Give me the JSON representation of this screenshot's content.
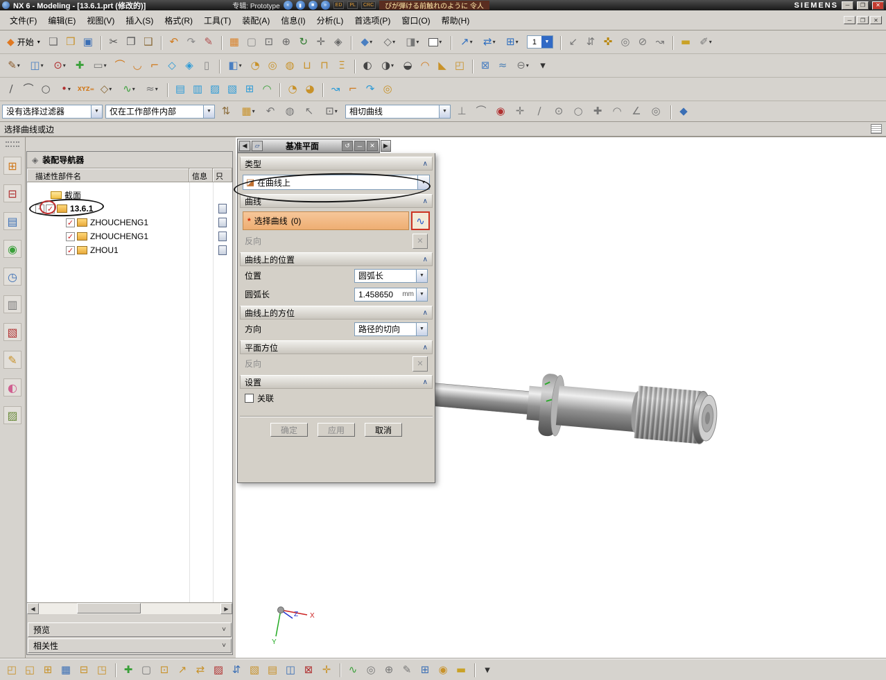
{
  "titlebar": {
    "title": "NX 6 - Modeling - [13.6.1.prt (修改的)]",
    "task_label": "专辑: Prototype",
    "media": [
      {
        "n": "recorder-prev-button",
        "g": "«"
      },
      {
        "n": "recorder-pause-button",
        "g": "▮"
      },
      {
        "n": "recorder-stop-button",
        "g": "■"
      },
      {
        "n": "recorder-next-button",
        "g": "»"
      }
    ],
    "rec_badges": [
      "ED",
      "PL",
      "CRC"
    ],
    "marquee": "ぴが弾ける前触れのように 令人",
    "brand": "SIEMENS"
  },
  "menubar": {
    "items": [
      "文件(F)",
      "编辑(E)",
      "视图(V)",
      "插入(S)",
      "格式(R)",
      "工具(T)",
      "装配(A)",
      "信息(I)",
      "分析(L)",
      "首选项(P)",
      "窗口(O)",
      "帮助(H)"
    ]
  },
  "toolbars": {
    "start_label": "开始",
    "start_icon": "◆",
    "layer_value": "1",
    "row1a": [
      {
        "n": "new-file-icon",
        "g": "❏",
        "c": "#6a6a6a"
      },
      {
        "n": "open-file-icon",
        "g": "❒",
        "c": "#c8922a"
      },
      {
        "n": "save-icon",
        "g": "▣",
        "c": "#3b6fb5"
      },
      {
        "n": "cut-icon",
        "g": "✂",
        "c": "#555555",
        "sep": true
      },
      {
        "n": "copy-icon",
        "g": "❐",
        "c": "#555555"
      },
      {
        "n": "paste-icon",
        "g": "❑",
        "c": "#8a6b3a"
      },
      {
        "n": "undo-icon",
        "g": "↶",
        "c": "#d07a1e",
        "sep": true
      },
      {
        "n": "redo-icon",
        "g": "↷",
        "c": "#8a8a8a"
      },
      {
        "n": "command-finder-icon",
        "g": "✎",
        "c": "#b05050"
      },
      {
        "n": "window-fit-icon",
        "g": "▦",
        "c": "#d9822a",
        "sep": true
      },
      {
        "n": "display-box-icon",
        "g": "▢",
        "c": "#8a8a8a"
      },
      {
        "n": "zoom-window-icon",
        "g": "⊡",
        "c": "#666666"
      },
      {
        "n": "zoom-in-icon",
        "g": "⊕",
        "c": "#666666"
      },
      {
        "n": "rotate-view-icon",
        "g": "↻",
        "c": "#2d7a2d"
      },
      {
        "n": "pan-view-icon",
        "g": "✛",
        "c": "#666666"
      },
      {
        "n": "perspective-icon",
        "g": "◈",
        "c": "#666666"
      },
      {
        "n": "shaded-display-icon",
        "g": "◆",
        "c": "#4a7fc1",
        "d": true,
        "sep": true
      },
      {
        "n": "wireframe-display-icon",
        "g": "◇",
        "c": "#666666",
        "d": true
      },
      {
        "n": "render-style-icon",
        "g": "◨",
        "c": "#777777",
        "d": true
      },
      {
        "n": "background-swatch-icon",
        "g": "",
        "c": "#ffffff",
        "cls": "swatch",
        "d": true
      },
      {
        "n": "move-object-icon",
        "g": "↗",
        "c": "#2f6fbf",
        "d": true,
        "sep": true
      },
      {
        "n": "copy-object-icon",
        "g": "⇄",
        "c": "#2f6fbf",
        "d": true
      },
      {
        "n": "pattern-object-icon",
        "g": "⊞",
        "c": "#2f6fbf",
        "d": true
      }
    ],
    "row1b": [
      {
        "n": "snap-handles-icon",
        "g": "↙",
        "c": "#777777",
        "sep": true
      },
      {
        "n": "snap-align-icon",
        "g": "⇵",
        "c": "#777777"
      },
      {
        "n": "selection-flower-icon",
        "g": "✜",
        "c": "#b8860b"
      },
      {
        "n": "target-point-icon",
        "g": "◎",
        "c": "#777777"
      },
      {
        "n": "no-selection-icon",
        "g": "⊘",
        "c": "#777777"
      },
      {
        "n": "quick-pick-icon",
        "g": "↝",
        "c": "#777777"
      },
      {
        "n": "measure-ruler-icon",
        "g": "▬",
        "c": "#c9a227",
        "sep": true
      },
      {
        "n": "annotation-pencil-icon",
        "g": "✐",
        "c": "#777777",
        "d": true
      }
    ],
    "row2": [
      {
        "n": "sketch-icon",
        "g": "✎",
        "c": "#8a5a2a",
        "d": true
      },
      {
        "n": "datum-plane-icon",
        "g": "◫",
        "c": "#4a7fc1",
        "d": true
      },
      {
        "n": "point-icon",
        "g": "⊙",
        "c": "#b03030",
        "d": true
      },
      {
        "n": "plus-icon",
        "g": "✚",
        "c": "#3aa03a"
      },
      {
        "n": "rect-icon",
        "g": "▭",
        "c": "#777777",
        "d": true
      },
      {
        "n": "arc-icon",
        "g": "⌒",
        "c": "#d07a1e"
      },
      {
        "n": "fillet-icon",
        "g": "◡",
        "c": "#d07a1e"
      },
      {
        "n": "profile-icon",
        "g": "⌐",
        "c": "#d07a1e"
      },
      {
        "n": "studio-surface-icon",
        "g": "◇",
        "c": "#2e9bd6"
      },
      {
        "n": "face-icon",
        "g": "◈",
        "c": "#2e9bd6"
      },
      {
        "n": "sheet-icon",
        "g": "▯",
        "c": "#888888"
      },
      {
        "n": "extrude-icon",
        "g": "◧",
        "c": "#4a7fc1",
        "d": true,
        "sep": true
      },
      {
        "n": "revolve-icon",
        "g": "◔",
        "c": "#c8922a"
      },
      {
        "n": "hole-icon",
        "g": "◎",
        "c": "#c8922a"
      },
      {
        "n": "boss-icon",
        "g": "◍",
        "c": "#c8922a"
      },
      {
        "n": "pocket-icon",
        "g": "⊔",
        "c": "#c8922a"
      },
      {
        "n": "pad-icon",
        "g": "⊓",
        "c": "#c8922a"
      },
      {
        "n": "emboss-icon",
        "g": "Ξ",
        "c": "#c8922a"
      },
      {
        "n": "unite-icon",
        "g": "◐",
        "c": "#444444",
        "sep": true
      },
      {
        "n": "subtract-icon",
        "g": "◑",
        "c": "#444444",
        "d": true
      },
      {
        "n": "intersect-icon",
        "g": "◒",
        "c": "#444444"
      },
      {
        "n": "edge-blend-icon",
        "g": "◠",
        "c": "#d07a1e"
      },
      {
        "n": "chamfer-icon",
        "g": "◣",
        "c": "#c8922a"
      },
      {
        "n": "shell-icon",
        "g": "◰",
        "c": "#c8922a"
      },
      {
        "n": "trim-body-icon",
        "g": "⊠",
        "c": "#4a7fc1",
        "sep": true
      },
      {
        "n": "sew-icon",
        "g": "≈",
        "c": "#4a7fb5"
      },
      {
        "n": "offset-icon",
        "g": "⊖",
        "c": "#777777",
        "d": true
      },
      {
        "n": "more-features-icon",
        "g": "▾",
        "c": "#333333"
      }
    ],
    "row3": [
      {
        "n": "line-icon",
        "g": "∕",
        "c": "#555555"
      },
      {
        "n": "arc-curve-icon",
        "g": "⌒",
        "c": "#555555"
      },
      {
        "n": "circle-icon",
        "g": "○",
        "c": "#555555"
      },
      {
        "n": "point-curve-icon",
        "g": "•",
        "c": "#b03030",
        "d": true
      },
      {
        "n": "xyz-icon",
        "g": "XYZ=",
        "c": "#d07a1e",
        "cls": "txtg"
      },
      {
        "n": "polygon-icon",
        "g": "◇",
        "c": "#8a6b3a",
        "d": true
      },
      {
        "n": "spline-icon",
        "g": "∿",
        "c": "#3aa03a",
        "d": true
      },
      {
        "n": "offset-curve-icon",
        "g": "≈",
        "c": "#777777",
        "d": true
      },
      {
        "n": "ruled-icon",
        "g": "▤",
        "c": "#2e9bd6",
        "sep": true
      },
      {
        "n": "through-curves-icon",
        "g": "▥",
        "c": "#2e9bd6"
      },
      {
        "n": "swept-icon",
        "g": "▨",
        "c": "#2e9bd6"
      },
      {
        "n": "n-sided-icon",
        "g": "▧",
        "c": "#2e9bd6"
      },
      {
        "n": "curve-mesh-icon",
        "g": "⊞",
        "c": "#2e9bd6"
      },
      {
        "n": "studio-spline-icon",
        "g": "◠",
        "c": "#3aa03a"
      },
      {
        "n": "extension-icon",
        "g": "◔",
        "c": "#c8922a",
        "sep": true
      },
      {
        "n": "law-extension-icon",
        "g": "◕",
        "c": "#c8922a"
      },
      {
        "n": "bridge-icon",
        "g": "↝",
        "c": "#2e9bd6",
        "sep": true
      },
      {
        "n": "corner-icon",
        "g": "⌐",
        "c": "#d07a1e"
      },
      {
        "n": "sweep-icon",
        "g": "↷",
        "c": "#2e9bd6"
      },
      {
        "n": "tube-icon",
        "g": "◎",
        "c": "#c8922a"
      }
    ]
  },
  "selection_bar": {
    "filter_value": "没有选择过滤器",
    "scope_value": "仅在工作部件内部",
    "curve_rule_value": "相切曲线",
    "icons_a": [
      {
        "n": "snap-pair-icon",
        "g": "⇅",
        "c": "#8a6b3a"
      },
      {
        "n": "grid-snap-icon",
        "g": "▦",
        "c": "#c8922a",
        "d": true
      },
      {
        "n": "previous-selection-icon",
        "g": "↶",
        "c": "#777777"
      },
      {
        "n": "highlight-sphere-icon",
        "g": "◍",
        "c": "#777777"
      },
      {
        "n": "cursor-pick-icon",
        "g": "↖",
        "c": "#777777"
      },
      {
        "n": "rectangle-select-icon",
        "g": "⊡",
        "c": "#666666",
        "d": true
      }
    ],
    "icons_c": [
      {
        "n": "stop-short-icon",
        "g": "⊥",
        "c": "#777777"
      },
      {
        "n": "follow-fillet-icon",
        "g": "⌒",
        "c": "#777777"
      },
      {
        "n": "magnify-icon",
        "g": "◉",
        "c": "#b03030"
      },
      {
        "n": "snap-midpoint-icon",
        "g": "✛",
        "c": "#777777"
      },
      {
        "n": "snap-endpoint-icon",
        "g": "∕",
        "c": "#777777"
      },
      {
        "n": "snap-arc-center-icon",
        "g": "⊙",
        "c": "#777777"
      },
      {
        "n": "snap-quadrant-icon",
        "g": "○",
        "c": "#777777"
      },
      {
        "n": "snap-intersection-icon",
        "g": "✚",
        "c": "#777777"
      },
      {
        "n": "snap-tangent-icon",
        "g": "◠",
        "c": "#777777"
      },
      {
        "n": "snap-angle-icon",
        "g": "∠",
        "c": "#777777"
      },
      {
        "n": "snap-point-on-curve-icon",
        "g": "◎",
        "c": "#777777"
      },
      {
        "n": "shaded-cube-icon",
        "g": "◆",
        "c": "#3b6fb5",
        "sep": true
      }
    ]
  },
  "prompt_bar": {
    "text": "选择曲线或边"
  },
  "resource_bar": {
    "icons": [
      {
        "n": "assembly-navigator-icon",
        "g": "⊞",
        "c": "#d07a1e"
      },
      {
        "n": "constraint-navigator-icon",
        "g": "⊟",
        "c": "#b03030"
      },
      {
        "n": "part-navigator-icon",
        "g": "▤",
        "c": "#3b6fb5"
      },
      {
        "n": "reuse-library-icon",
        "g": "◉",
        "c": "#3aa03a"
      },
      {
        "n": "history-icon",
        "g": "◷",
        "c": "#3b6fb5"
      },
      {
        "n": "system-materials-icon",
        "g": "▥",
        "c": "#777777"
      },
      {
        "n": "process-studio-icon",
        "g": "▧",
        "c": "#b03030"
      },
      {
        "n": "manufacturing-wizard-icon",
        "g": "✎",
        "c": "#c8922a"
      },
      {
        "n": "roles-icon",
        "g": "◐",
        "c": "#d06090"
      },
      {
        "n": "visualization-icon",
        "g": "▨",
        "c": "#6a8a3a"
      }
    ]
  },
  "navigator": {
    "title": "装配导航器",
    "col_name": "描述性部件名",
    "col_info": "信息",
    "col_only": "只",
    "rows": [
      {
        "label": "截面",
        "kind": "folder",
        "indent": 1
      },
      {
        "label": "13.6.1",
        "kind": "assembly",
        "indent": 0,
        "checked": true,
        "annotated": true
      },
      {
        "label": "ZHOUCHENG1",
        "kind": "part",
        "indent": 2,
        "checked": true
      },
      {
        "label": "ZHOUCHENG1",
        "kind": "part",
        "indent": 2,
        "checked": true
      },
      {
        "label": "ZHOU1",
        "kind": "part",
        "indent": 2,
        "checked": true
      }
    ],
    "preview_label": "预览",
    "dependencies_label": "相关性"
  },
  "dialog": {
    "title": "基准平面",
    "sections": {
      "type": "类型",
      "curve": "曲线",
      "location": "曲线上的位置",
      "orientation": "曲线上的方位",
      "plane": "平面方位",
      "settings": "设置"
    },
    "type_icon": "◪",
    "type_value": "在曲线上",
    "select_star": "*",
    "select_curve_label": "选择曲线",
    "select_curve_count": "(0)",
    "select_curve_icon": "∿",
    "reverse_label": "反向",
    "position_label": "位置",
    "position_value": "圆弧长",
    "arclength_label": "圆弧长",
    "arclength_value": "1.458650",
    "arclength_unit": "mm",
    "direction_label": "方向",
    "direction_value": "路径的切向",
    "plane_reverse_label": "反向",
    "associative_label": "关联",
    "ok_label": "确定",
    "apply_label": "应用",
    "cancel_label": "取消"
  },
  "viewport": {
    "axis_x": "X",
    "axis_y": "Y",
    "axis_z": "Z"
  },
  "bottom_bar": {
    "icons": [
      {
        "n": "find-component-icon",
        "g": "◰",
        "c": "#c8922a"
      },
      {
        "n": "open-component-icon",
        "g": "◱",
        "c": "#c8922a"
      },
      {
        "n": "component-window-icon",
        "g": "⊞",
        "c": "#c8922a"
      },
      {
        "n": "fit-window-icon",
        "g": "▦",
        "c": "#3b6fb5"
      },
      {
        "n": "close-component-icon",
        "g": "⊟",
        "c": "#c8922a"
      },
      {
        "n": "work-part-icon",
        "g": "◳",
        "c": "#c8922a"
      },
      {
        "n": "add-component-icon",
        "g": "✚",
        "c": "#3aa03a",
        "sep": true
      },
      {
        "n": "new-component-icon",
        "g": "▢",
        "c": "#777777"
      },
      {
        "n": "pattern-component-icon",
        "g": "⊡",
        "c": "#c8922a"
      },
      {
        "n": "move-component-icon",
        "g": "↗",
        "c": "#c8922a"
      },
      {
        "n": "replace-component-icon",
        "g": "⇄",
        "c": "#c8922a"
      },
      {
        "n": "suppress-component-icon",
        "g": "▨",
        "c": "#b03030"
      },
      {
        "n": "assembly-constraints-icon",
        "g": "⇵",
        "c": "#3b6fb5"
      },
      {
        "n": "mirror-assembly-icon",
        "g": "▧",
        "c": "#c8922a"
      },
      {
        "n": "sequence-icon",
        "g": "▤",
        "c": "#c8922a"
      },
      {
        "n": "arrangements-icon",
        "g": "◫",
        "c": "#3b6fb5"
      },
      {
        "n": "interference-icon",
        "g": "⊠",
        "c": "#b03030"
      },
      {
        "n": "explode-icon",
        "g": "✛",
        "c": "#c8922a"
      },
      {
        "n": "wave-link-icon",
        "g": "∿",
        "c": "#3aa03a",
        "sep": true
      },
      {
        "n": "clearance-icon",
        "g": "◎",
        "c": "#777777"
      },
      {
        "n": "product-interface-icon",
        "g": "⊕",
        "c": "#777777"
      },
      {
        "n": "relations-icon",
        "g": "✎",
        "c": "#777777"
      },
      {
        "n": "center-view-icon",
        "g": "⊞",
        "c": "#3b6fb5"
      },
      {
        "n": "spline-tool-icon",
        "g": "◉",
        "c": "#c8922a"
      },
      {
        "n": "measure-icon",
        "g": "▬",
        "c": "#c9a227"
      },
      {
        "n": "overflow-icon",
        "g": "▾",
        "c": "#333333",
        "sep": true
      }
    ]
  }
}
